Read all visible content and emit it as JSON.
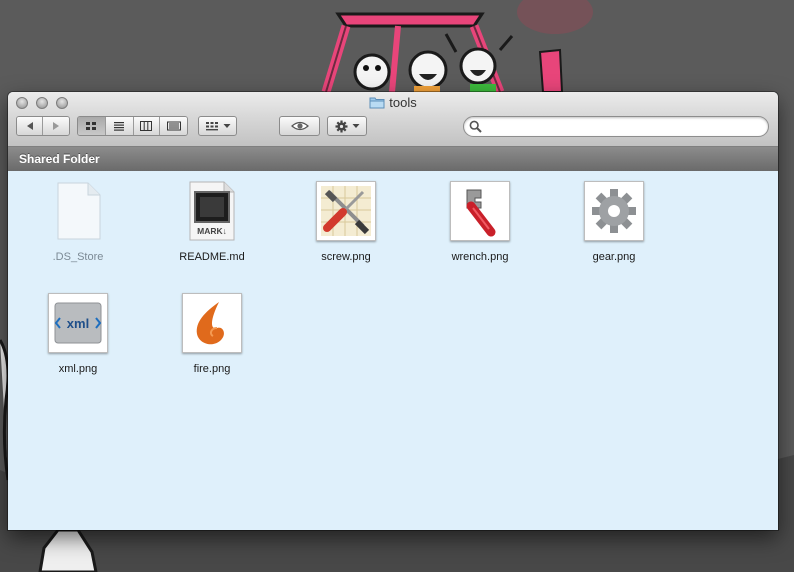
{
  "window": {
    "title": "tools",
    "path_header": "Shared Folder"
  },
  "toolbar": {
    "back_label": "◀",
    "forward_label": "▶",
    "view_modes": [
      "icon-view",
      "list-view",
      "column-view",
      "coverflow-view"
    ],
    "active_view": "icon-view",
    "search_placeholder": ""
  },
  "files": [
    {
      "name": ".DS_Store",
      "icon": "blank-document-icon",
      "hidden": true
    },
    {
      "name": "README.md",
      "icon": "markdown-icon",
      "badge_text": "MARK↓"
    },
    {
      "name": "screw.png",
      "icon": "screwdriver-icon"
    },
    {
      "name": "wrench.png",
      "icon": "wrench-icon"
    },
    {
      "name": "gear.png",
      "icon": "gear-icon"
    },
    {
      "name": "xml.png",
      "icon": "xml-icon",
      "badge_text": "xml"
    },
    {
      "name": "fire.png",
      "icon": "fire-icon"
    }
  ],
  "colors": {
    "content_background": "#dff0fb",
    "path_bar": "#787878",
    "desktop_background": "#5b5b5b"
  }
}
